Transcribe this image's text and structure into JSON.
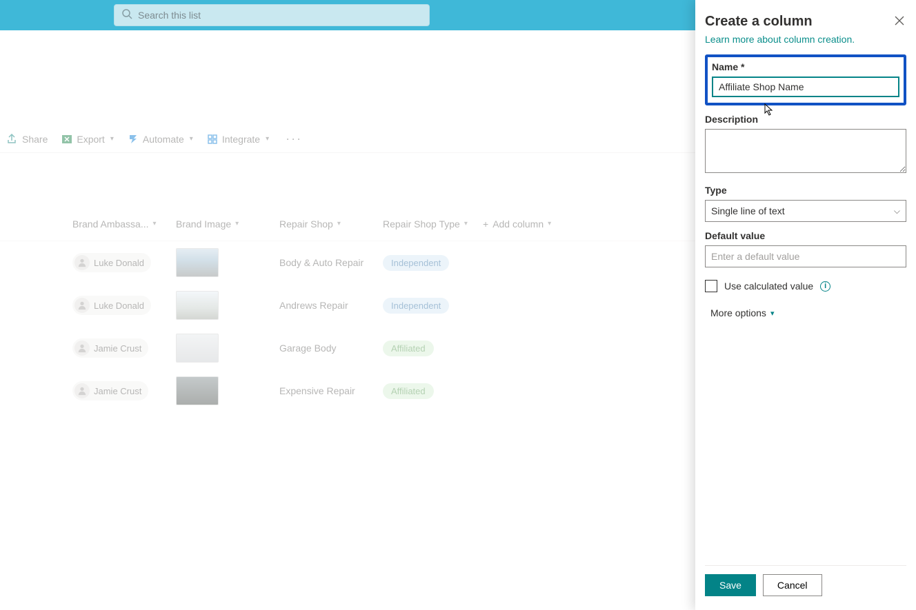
{
  "search": {
    "placeholder": "Search this list"
  },
  "commands": {
    "share": "Share",
    "export": "Export",
    "automate": "Automate",
    "integrate": "Integrate"
  },
  "columns": {
    "ambassador": "Brand Ambassa...",
    "image": "Brand Image",
    "shop": "Repair Shop",
    "shoptype": "Repair Shop Type",
    "add": "Add column"
  },
  "rows": [
    {
      "person": "Luke Donald",
      "shop": "Body & Auto Repair",
      "type": "Independent",
      "typeClass": "independent",
      "thumbClass": "t1"
    },
    {
      "person": "Luke Donald",
      "shop": "Andrews Repair",
      "type": "Independent",
      "typeClass": "independent",
      "thumbClass": "t2"
    },
    {
      "person": "Jamie Crust",
      "shop": "Garage Body",
      "type": "Affiliated",
      "typeClass": "affiliated",
      "thumbClass": "t3"
    },
    {
      "person": "Jamie Crust",
      "shop": "Expensive Repair",
      "type": "Affiliated",
      "typeClass": "affiliated",
      "thumbClass": "t4"
    }
  ],
  "panel": {
    "title": "Create a column",
    "learn": "Learn more about column creation.",
    "name_label": "Name *",
    "name_value": "Affiliate Shop Name",
    "desc_label": "Description",
    "type_label": "Type",
    "type_value": "Single line of text",
    "default_label": "Default value",
    "default_placeholder": "Enter a default value",
    "calc_label": "Use calculated value",
    "more": "More options",
    "save": "Save",
    "cancel": "Cancel"
  }
}
